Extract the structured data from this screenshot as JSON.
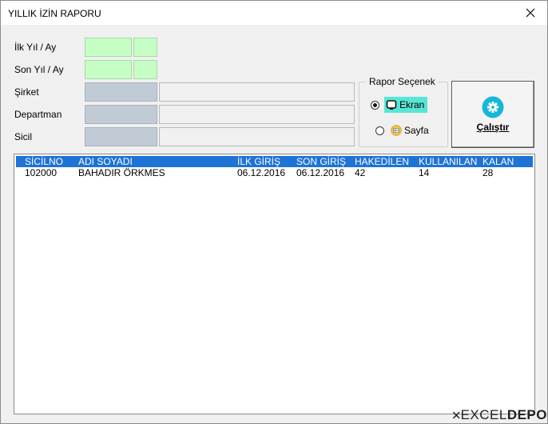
{
  "window": {
    "title": "YILLIK İZİN RAPORU"
  },
  "form": {
    "ilk_yil_ay_label": "İlk Yıl / Ay",
    "son_yil_ay_label": "Son Yıl / Ay",
    "sirket_label": "Şirket",
    "departman_label": "Departman",
    "sicil_label": "Sicil"
  },
  "rapor": {
    "group_title": "Rapor Seçenek",
    "options": [
      {
        "label": "Ekran",
        "selected": true
      },
      {
        "label": "Sayfa",
        "selected": false
      }
    ]
  },
  "run_button": {
    "label": "Çalıştır"
  },
  "list": {
    "columns": [
      "SİCİLNO",
      "ADI SOYADI",
      "İLK GİRİŞ",
      "SON GİRİŞ",
      "HAKEDİLEN",
      "KULLANILAN",
      "KALAN"
    ],
    "rows": [
      [
        "102000",
        "BAHADIR ÖRKMES",
        "06.12.2016",
        "06.12.2016",
        "42",
        "14",
        "28"
      ]
    ]
  },
  "logo": {
    "part1": "EXCEL",
    "part2": "DEPO"
  },
  "colors": {
    "accent_teal": "#57e6d4",
    "list_header": "#1e73d6",
    "green_field": "#c5ffc5",
    "grey_field": "#c1cbd6"
  }
}
